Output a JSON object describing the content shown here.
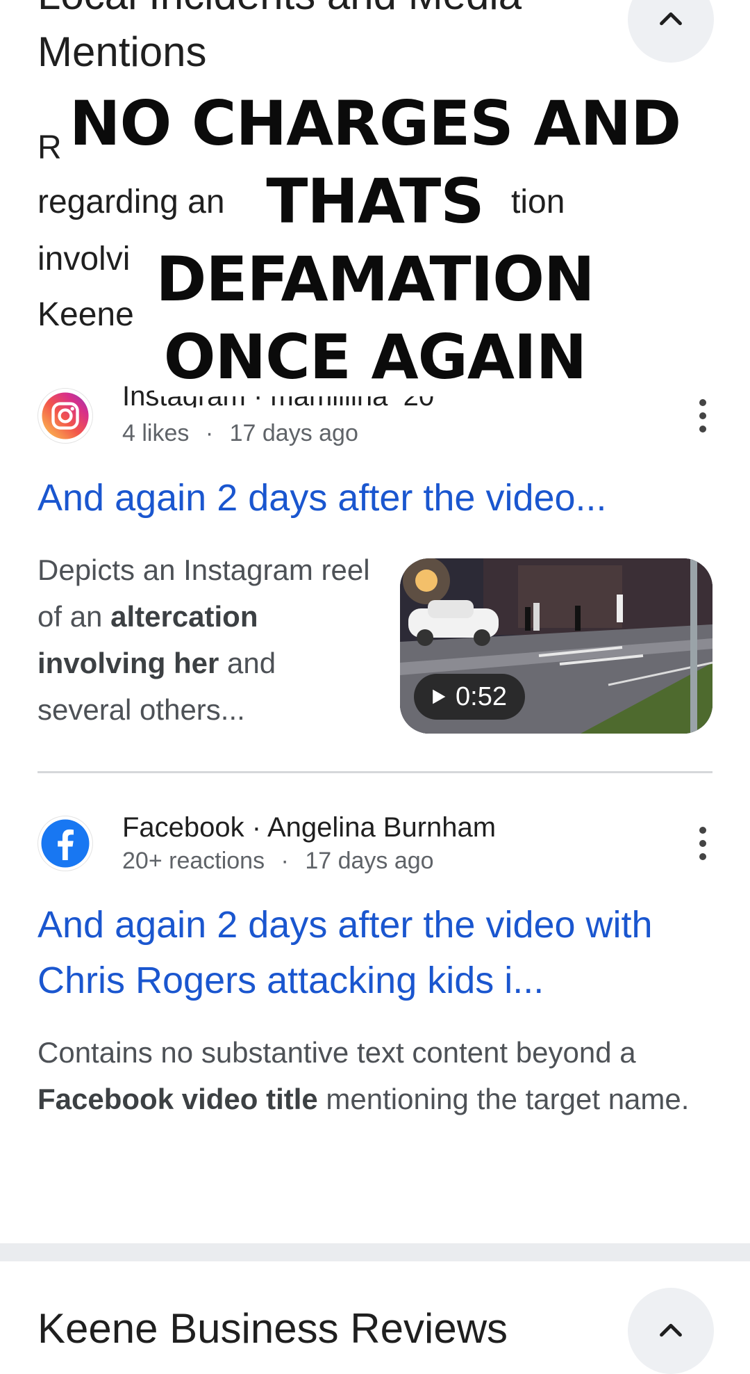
{
  "section1": {
    "title_line1": "Local Incidents and Media",
    "title_line2": "Mentions",
    "summary_frag1": "Re",
    "summary_frag2": "regarding an",
    "summary_frag3": "tion",
    "summary_frag4": "involvi",
    "summary_frag5": "Keene"
  },
  "overlay": {
    "line1": "NO CHARGES AND",
    "line2": "THATS",
    "line3": "DEFAMATION",
    "line4": "ONCE AGAIN"
  },
  "results": [
    {
      "source": "Instagram · mamiiiina_20",
      "engagement": "4 likes",
      "age": "17 days ago",
      "title": "And again 2 days after the video...",
      "snippet_pre": "Depicts an Instagram reel of an ",
      "snippet_bold": "altercation involving her",
      "snippet_post": " and several others...",
      "video_duration": "0:52"
    },
    {
      "source": "Facebook · Angelina Burnham",
      "engagement": "20+ reactions",
      "age": "17 days ago",
      "title": "And again 2 days after the video with Chris Rogers attacking kids i...",
      "snippet_pre": "Contains no substantive text content beyond a ",
      "snippet_bold": "Facebook video title",
      "snippet_post": " mentioning the target name."
    }
  ],
  "section2": {
    "title": "Keene Business Reviews"
  },
  "separator": "·",
  "icons": [
    "chevron-up-icon",
    "instagram-icon",
    "facebook-icon",
    "more-vert-icon",
    "play-icon"
  ],
  "colors": {
    "link": "#1a56cf",
    "meta": "#5f6368",
    "instagram": "#e1306c",
    "facebook": "#1877f2"
  }
}
